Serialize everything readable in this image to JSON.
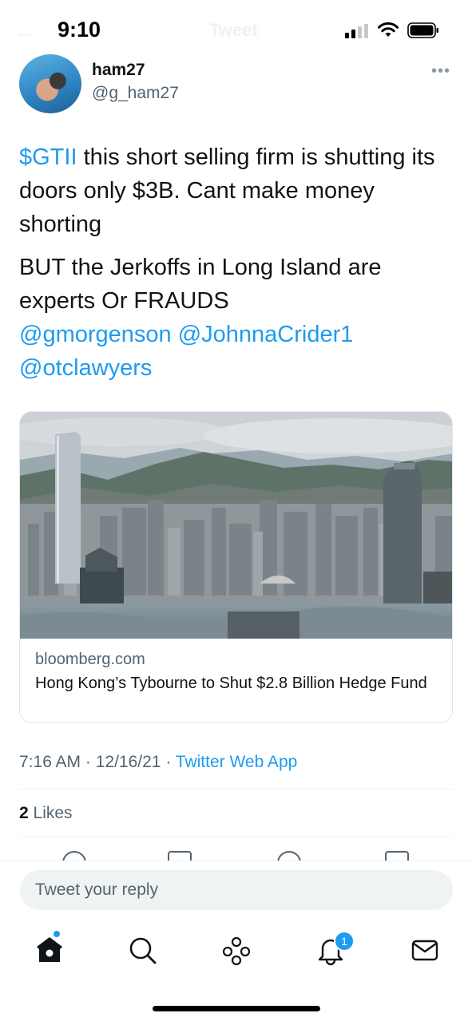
{
  "status_bar": {
    "time": "9:10",
    "ghost_title": "Tweet",
    "ghost_back": "←"
  },
  "author": {
    "display_name": "ham27",
    "handle": "@g_ham27",
    "more_icon": "more-dots-icon"
  },
  "tweet": {
    "line1_cashtag": "$GTII",
    "line1_rest": " this short selling firm is shutting its doors only $3B. Cant make money shorting",
    "para2": "BUT the Jerkoffs in Long Island are experts Or FRAUDS",
    "mention1": "@gmorgenson",
    "mention2": "@JohnnaCrider1",
    "mention3": "@otclawyers"
  },
  "card": {
    "domain": "bloomberg.com",
    "title": "Hong Kong’s Tybourne to Shut $2.8 Billion Hedge Fund",
    "image": "hong-kong-skyline-photo"
  },
  "meta": {
    "time": "7:16 AM",
    "sep1": " · ",
    "date": "12/16/21",
    "sep2": " · ",
    "app": "Twitter Web App"
  },
  "likes": {
    "count": "2",
    "label": " Likes"
  },
  "reply": {
    "placeholder": "Tweet your reply"
  },
  "tab_bar": {
    "items": [
      "home-icon",
      "search-icon",
      "spaces-icon",
      "notifications-icon",
      "messages-icon"
    ],
    "notification_badge": "1"
  },
  "colors": {
    "link": "#1d9bf0",
    "text": "#0f1419",
    "secondary": "#536471"
  }
}
